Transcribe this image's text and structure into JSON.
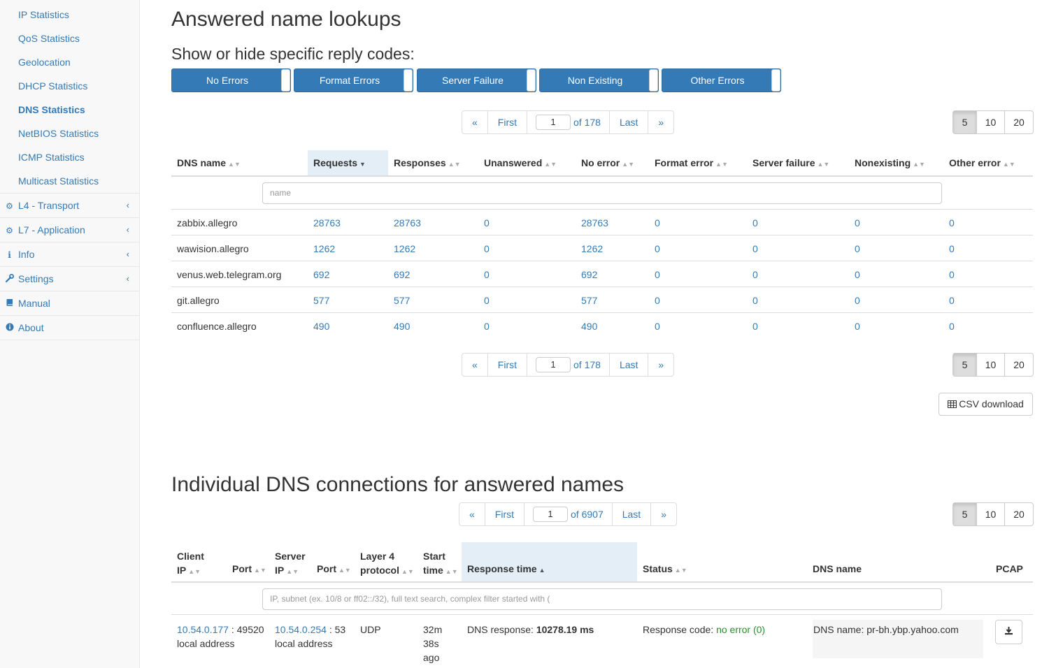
{
  "sidebar": {
    "sub_items": [
      "IP Statistics",
      "QoS Statistics",
      "Geolocation",
      "DHCP Statistics",
      "DNS Statistics",
      "NetBIOS Statistics",
      "ICMP Statistics",
      "Multicast Statistics"
    ],
    "main_items": [
      {
        "label": "L4 - Transport",
        "icon": "gear-icon"
      },
      {
        "label": "L7 - Application",
        "icon": "gear-icon"
      },
      {
        "label": "Info",
        "icon": "info-icon"
      },
      {
        "label": "Settings",
        "icon": "wrench-icon"
      },
      {
        "label": "Manual",
        "icon": "book-icon"
      },
      {
        "label": "About",
        "icon": "info-circle-icon"
      }
    ]
  },
  "lookups": {
    "title": "Answered name lookups",
    "toggle_title": "Show or hide specific reply codes:",
    "toggles": [
      "No Errors",
      "Format Errors",
      "Server Failure",
      "Non Existing",
      "Other Errors"
    ],
    "pager": {
      "prev": "«",
      "first": "First",
      "page": "1",
      "of": "of 178",
      "last": "Last",
      "next": "»"
    },
    "sizes": [
      "5",
      "10",
      "20"
    ],
    "columns": [
      "DNS name",
      "Requests",
      "Responses",
      "Unanswered",
      "No error",
      "Format error",
      "Server failure",
      "Nonexisting",
      "Other error"
    ],
    "filter_placeholder": "name",
    "rows": [
      [
        "zabbix.allegro",
        "28763",
        "28763",
        "0",
        "28763",
        "0",
        "0",
        "0",
        "0"
      ],
      [
        "wawision.allegro",
        "1262",
        "1262",
        "0",
        "1262",
        "0",
        "0",
        "0",
        "0"
      ],
      [
        "venus.web.telegram.org",
        "692",
        "692",
        "0",
        "692",
        "0",
        "0",
        "0",
        "0"
      ],
      [
        "git.allegro",
        "577",
        "577",
        "0",
        "577",
        "0",
        "0",
        "0",
        "0"
      ],
      [
        "confluence.allegro",
        "490",
        "490",
        "0",
        "490",
        "0",
        "0",
        "0",
        "0"
      ]
    ],
    "csv_label": "CSV download"
  },
  "connections": {
    "title": "Individual DNS connections for answered names",
    "pager": {
      "prev": "«",
      "first": "First",
      "page": "1",
      "of": "of 6907",
      "last": "Last",
      "next": "»"
    },
    "sizes": [
      "5",
      "10",
      "20"
    ],
    "columns": {
      "client_ip": [
        "Client",
        "IP"
      ],
      "client_port": "Port",
      "server_ip": [
        "Server",
        "IP"
      ],
      "server_port": "Port",
      "layer4": [
        "Layer 4",
        "protocol"
      ],
      "start_time": [
        "Start",
        "time"
      ],
      "response_time": "Response time",
      "status": "Status",
      "dns_name": "DNS name",
      "pcap": "PCAP"
    },
    "filter_placeholder": "IP, subnet (ex. 10/8 or ff02::/32), full text search, complex filter started with (",
    "row": {
      "client_ip": "10.54.0.177",
      "client_port": ": 49520",
      "client_note": "local address",
      "server_ip": "10.54.0.254",
      "server_port": ": 53",
      "server_note": "local address",
      "protocol": "UDP",
      "start_time": [
        "32m",
        "38s",
        "ago"
      ],
      "response_label": "DNS response:",
      "response_value": "10278.19 ms",
      "status_label": "Response code:",
      "status_value": "no error (0)",
      "dns_name": "DNS name: pr-bh.ybp.yahoo.com"
    }
  },
  "colors": {
    "link": "#337ab7",
    "toggle": "#337ab7",
    "ok": "#2e8b2e"
  }
}
